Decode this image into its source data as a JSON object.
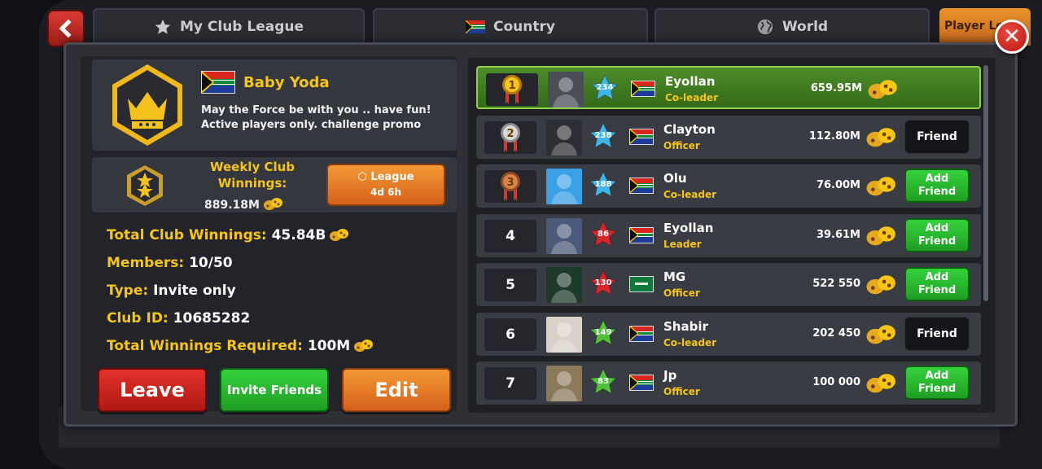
{
  "tabs": [
    {
      "label": "My Club League",
      "icon": "star-icon"
    },
    {
      "label": "Country",
      "icon": "flag-icon"
    },
    {
      "label": "World",
      "icon": "globe-icon"
    },
    {
      "label": "Player Le",
      "icon": ""
    }
  ],
  "club": {
    "name": "Baby Yoda",
    "description": "May the Force be with you      ..  have fun! Active players only. challenge promo",
    "weekly_title": "Weekly Club Winnings:",
    "weekly_value": "889.18M",
    "league_label": "League",
    "league_time": "4d 6h",
    "stats": [
      {
        "key": "Total Club Winnings:",
        "value": "45.84B",
        "coins": true
      },
      {
        "key": "Members:",
        "value": "10/50",
        "coins": false
      },
      {
        "key": "Type:",
        "value": "Invite only",
        "coins": false
      },
      {
        "key": "Club ID:",
        "value": "10685282",
        "coins": false
      },
      {
        "key": "Total Winnings Required:",
        "value": "100M",
        "coins": true
      }
    ]
  },
  "buttons": {
    "leave": "Leave",
    "invite": "Invite Friends",
    "edit": "Edit"
  },
  "members": [
    {
      "rank": "1",
      "level": "234",
      "star_color": "#3fb6ea",
      "flag": "za",
      "name": "Eyollan",
      "role": "Co-leader",
      "winnings": "659.95M",
      "action": "",
      "me": true
    },
    {
      "rank": "2",
      "level": "238",
      "star_color": "#3fb6ea",
      "flag": "za",
      "name": "Clayton",
      "role": "Officer",
      "winnings": "112.80M",
      "action": "Friend",
      "me": false
    },
    {
      "rank": "3",
      "level": "188",
      "star_color": "#3fb6ea",
      "flag": "za",
      "name": "Olu",
      "role": "Co-leader",
      "winnings": "76.00M",
      "action": "Add Friend",
      "me": false
    },
    {
      "rank": "4",
      "level": "86",
      "star_color": "#d6252b",
      "flag": "za",
      "name": "Eyollan",
      "role": "Leader",
      "winnings": "39.61M",
      "action": "Add Friend",
      "me": false
    },
    {
      "rank": "5",
      "level": "130",
      "star_color": "#d6252b",
      "flag": "sa",
      "name": "MG",
      "role": "Officer",
      "winnings": "522 550",
      "action": "Add Friend",
      "me": false
    },
    {
      "rank": "6",
      "level": "149",
      "star_color": "#4fc23a",
      "flag": "za",
      "name": "Shabir",
      "role": "Co-leader",
      "winnings": "202 450",
      "action": "Friend",
      "me": false
    },
    {
      "rank": "7",
      "level": "83",
      "star_color": "#4fc23a",
      "flag": "za",
      "name": "Jp",
      "role": "Officer",
      "winnings": "100 000",
      "action": "Add Friend",
      "me": false
    }
  ],
  "colors": {
    "accent_yellow": "#f5c518",
    "green": "#2ec235",
    "orange": "#e67a26",
    "red": "#d2261f"
  }
}
